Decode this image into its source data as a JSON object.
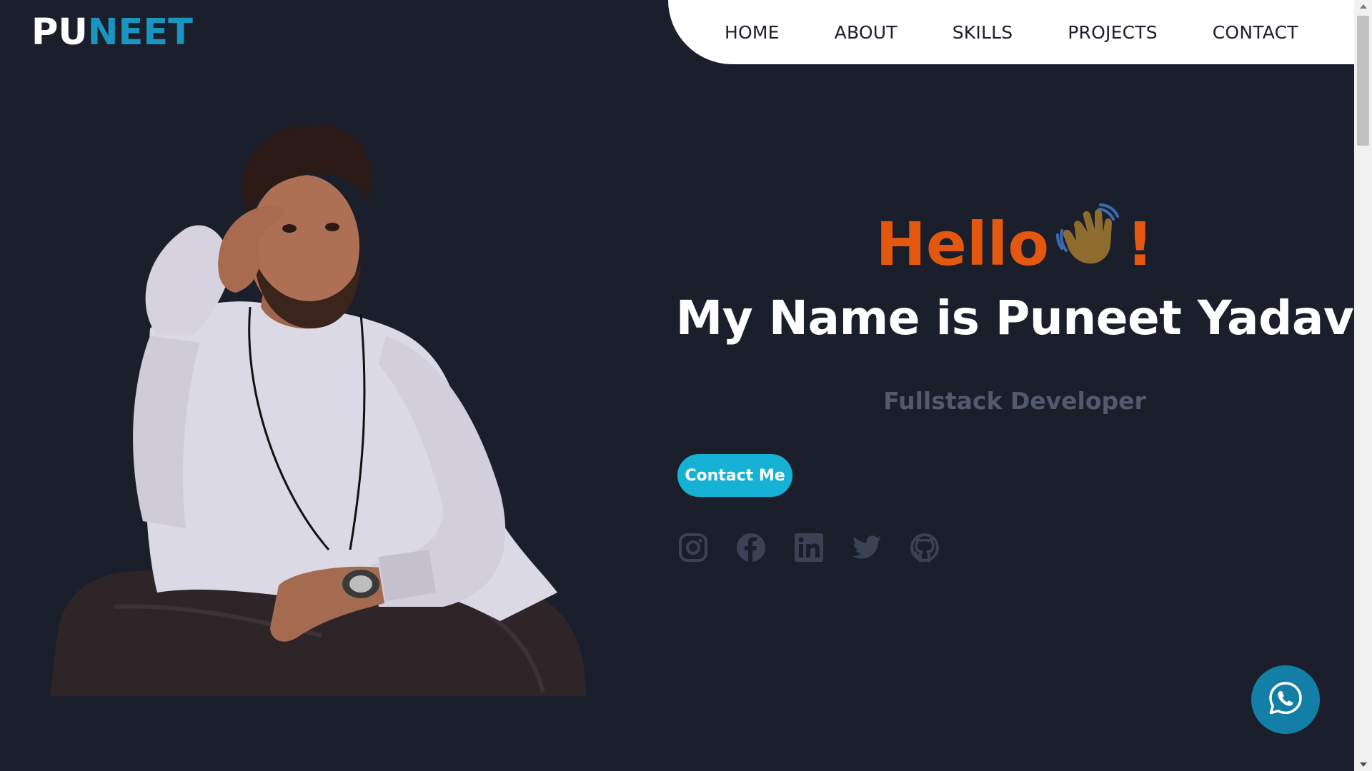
{
  "logo": {
    "part_a": "PU",
    "part_b": "NEET"
  },
  "nav": {
    "items": [
      {
        "label": "HOME"
      },
      {
        "label": "ABOUT"
      },
      {
        "label": "SKILLS"
      },
      {
        "label": "PROJECTS"
      },
      {
        "label": "CONTACT"
      }
    ]
  },
  "hero": {
    "greeting": "Hello",
    "greeting_emoji": "waving-hand-icon",
    "greeting_suffix": "!",
    "name": "My Name is Puneet Yadav",
    "role": "Fullstack Developer",
    "cta_label": "Contact Me"
  },
  "socials": [
    {
      "icon": "instagram-icon"
    },
    {
      "icon": "facebook-icon"
    },
    {
      "icon": "linkedin-icon"
    },
    {
      "icon": "twitter-icon"
    },
    {
      "icon": "github-icon"
    }
  ],
  "floating": {
    "icon": "whatsapp-icon"
  },
  "colors": {
    "background": "#1b1f2b",
    "accent_orange": "#e4570f",
    "accent_cyan": "#16b2d6",
    "logo_blue": "#1a95c0",
    "muted_text": "#525a6d",
    "icon_gray": "#3a4254",
    "whatsapp_bg": "#137ea6"
  }
}
